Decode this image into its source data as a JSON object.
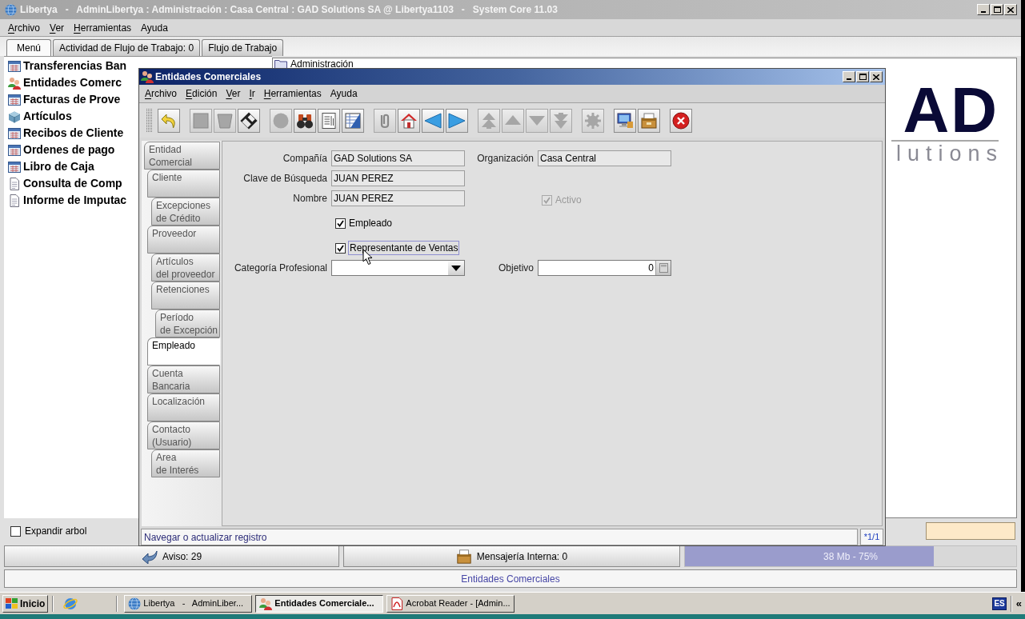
{
  "main_window": {
    "title": "Libertya   -   AdminLibertya : Administración : Casa Central : GAD Solutions SA @ Libertya1103   -   System Core 11.03",
    "menu": [
      {
        "label": "Archivo",
        "underline_first": true
      },
      {
        "label": "Ver",
        "underline_first": true
      },
      {
        "label": "Herramientas",
        "underline_first": true
      },
      {
        "label": "Ayuda",
        "underline_first": false
      }
    ],
    "tabs": [
      {
        "label": "Menú",
        "selected": true
      },
      {
        "label": "Actividad de Flujo de Trabajo: 0",
        "selected": false
      },
      {
        "label": "Flujo de Trabajo",
        "selected": false
      }
    ],
    "menu_tree": [
      {
        "label": "Transferencias Ban",
        "kind": "window"
      },
      {
        "label": "Entidades Comerc",
        "kind": "people"
      },
      {
        "label": "Facturas de Prove",
        "kind": "window"
      },
      {
        "label": "Artículos",
        "kind": "product"
      },
      {
        "label": "Recibos de Cliente",
        "kind": "window"
      },
      {
        "label": "Ordenes de pago",
        "kind": "window"
      },
      {
        "label": "Libro de Caja",
        "kind": "window"
      },
      {
        "label": "Consulta de Comp",
        "kind": "report"
      },
      {
        "label": "Informe de Imputac",
        "kind": "report"
      }
    ],
    "expand_tree": {
      "label": "Expandir arbol",
      "checked": false
    },
    "folder_tree": [
      {
        "label": "Administración"
      }
    ],
    "logo": {
      "mark": "AD",
      "tagline": "lutions"
    },
    "status": {
      "notices": "Aviso: 29",
      "messages": "Mensajería Interna: 0",
      "memory": {
        "reading": "38 Mb - 75%",
        "level": 0.75
      }
    },
    "caption": "Entidades Comerciales"
  },
  "window": {
    "title": "Entidades Comerciales",
    "menu": [
      {
        "label": "Archivo",
        "underline_first": true
      },
      {
        "label": "Edición",
        "underline_first": true
      },
      {
        "label": "Ver",
        "underline_first": true
      },
      {
        "label": "Ir",
        "underline_first": true
      },
      {
        "label": "Herramientas",
        "underline_first": true
      },
      {
        "label": "Ayuda",
        "underline_first": false
      }
    ],
    "toolbar": {
      "groups": [
        {
          "buttons": [
            {
              "kind": "undo",
              "disabled": false
            }
          ]
        },
        {
          "buttons": [
            {
              "kind": "new",
              "disabled": true
            },
            {
              "kind": "delete",
              "disabled": true
            },
            {
              "kind": "save",
              "disabled": false
            }
          ]
        },
        {
          "buttons": [
            {
              "kind": "refresh",
              "disabled": true
            },
            {
              "kind": "find",
              "disabled": false
            },
            {
              "kind": "report",
              "disabled": false
            },
            {
              "kind": "grid",
              "disabled": false
            }
          ]
        },
        {
          "buttons": [
            {
              "kind": "attach",
              "disabled": true
            },
            {
              "kind": "home",
              "disabled": false
            },
            {
              "kind": "previous",
              "disabled": false
            },
            {
              "kind": "next",
              "disabled": false
            }
          ]
        },
        {
          "buttons": [
            {
              "kind": "first",
              "disabled": true
            },
            {
              "kind": "up",
              "disabled": true
            },
            {
              "kind": "down",
              "disabled": true
            },
            {
              "kind": "last",
              "disabled": true
            }
          ]
        },
        {
          "buttons": [
            {
              "kind": "process",
              "disabled": true
            }
          ]
        },
        {
          "buttons": [
            {
              "kind": "monitor",
              "disabled": false
            },
            {
              "kind": "archive",
              "disabled": false
            }
          ]
        },
        {
          "buttons": [
            {
              "kind": "close",
              "disabled": false
            }
          ]
        }
      ]
    },
    "tabs": [
      {
        "label": "Entidad\nComercial",
        "selected": false,
        "children": [
          {
            "label": "Cliente",
            "selected": false,
            "children": [
              {
                "label": "Excepciones\nde Crédito",
                "selected": false
              }
            ]
          },
          {
            "label": "Proveedor",
            "selected": false,
            "children": [
              {
                "label": "Artículos\ndel proveedor",
                "selected": false
              },
              {
                "label": "Retenciones",
                "selected": false,
                "children": [
                  {
                    "label": "Período\nde Excepción",
                    "selected": false
                  }
                ]
              }
            ]
          },
          {
            "label": "Empleado",
            "selected": true
          },
          {
            "label": "Cuenta\nBancaria",
            "selected": false
          },
          {
            "label": "Localización",
            "selected": false
          },
          {
            "label": "Contacto\n(Usuario)",
            "selected": false,
            "children": [
              {
                "label": "Area\nde Interés",
                "selected": false
              }
            ]
          }
        ]
      }
    ],
    "form": {
      "company": {
        "label": "Compañía",
        "value": "GAD Solutions SA",
        "read_only": true
      },
      "organization": {
        "label": "Organización",
        "value": "Casa Central",
        "read_only": true
      },
      "search_key": {
        "label": "Clave de Búsqueda",
        "value": "JUAN PEREZ",
        "read_only": true
      },
      "name": {
        "label": "Nombre",
        "value": "JUAN PEREZ",
        "read_only": true
      },
      "active": {
        "label": "Activo",
        "checked": true,
        "disabled": true
      },
      "employee": {
        "label": "Empleado",
        "checked": true,
        "disabled": false
      },
      "sales_rep": {
        "label": "Representante de Ventas",
        "checked": true,
        "disabled": false,
        "focused": true
      },
      "job_category": {
        "label": "Categoría Profesional",
        "read_only": false
      },
      "goal": {
        "label": "Objetivo",
        "value": "0",
        "read_only": false
      }
    },
    "status": {
      "message": "Navegar o actualizar registro",
      "record": "*1/1"
    }
  },
  "taskbar": {
    "start": "Inicio",
    "tasks": [
      {
        "label": "Libertya   -   AdminLiber...",
        "kind": "app",
        "selected": false
      },
      {
        "label": "Entidades Comerciale...",
        "kind": "people",
        "selected": true
      },
      {
        "label": "Acrobat Reader - [Admin...",
        "kind": "pdf",
        "selected": false
      }
    ],
    "language": "ES",
    "expand": "«"
  }
}
